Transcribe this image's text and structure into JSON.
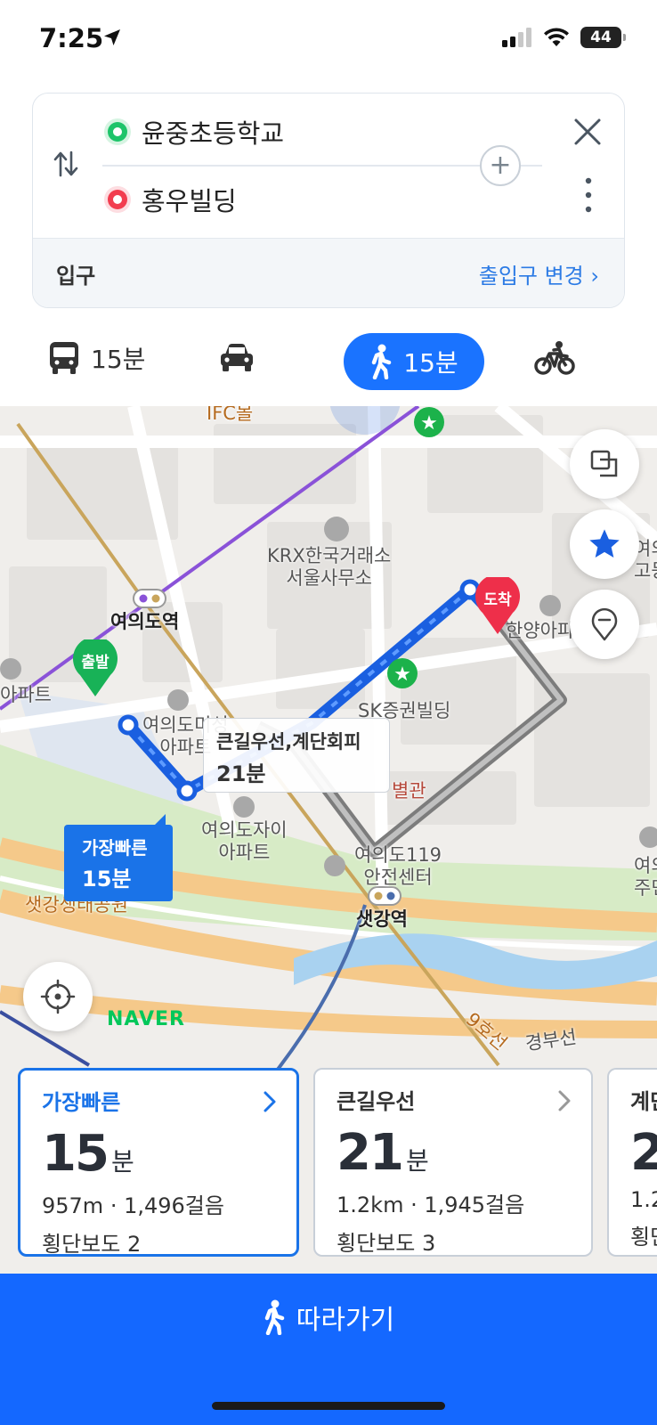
{
  "status": {
    "time": "7:25",
    "battery": "44"
  },
  "route": {
    "origin": "윤중초등학교",
    "destination": "홍우빌딩",
    "entrance_label": "입구",
    "entrance_change": "출입구 변경 ›"
  },
  "tabs": {
    "transit_time": "15분",
    "walk_time": "15분"
  },
  "map": {
    "labels": {
      "ifc": "IFC몰",
      "krx_1": "KRX한국거래소",
      "krx_2": "서울사무소",
      "yeouido_station": "여의도역",
      "apt_left": "아파트",
      "yeouido_apt_1": "여의도미성",
      "yeouido_apt_2": "아파트",
      "sk": "SK증권빌딩",
      "byeolgwan": "별관",
      "jai_1": "여의도자이",
      "jai_2": "아파트",
      "center_119_1": "여의도119",
      "center_119_2": "안전센터",
      "saetgang_station": "샛강역",
      "saetgang_park": "샛강생태공원",
      "hanyang": "한양아파",
      "right_1": "여의",
      "right_2": "고등",
      "right_3": "여의",
      "right_4": "주민",
      "line9": "9호선",
      "gyeongbu": "경부선"
    },
    "pins": {
      "start": "출발",
      "arrive": "도착"
    },
    "callout": {
      "title": "큰길우선,계단회피",
      "time": "21분"
    },
    "fastest": {
      "label": "가장빠른",
      "time": "15분"
    },
    "logo": "NAVER"
  },
  "results": [
    {
      "title": "가장빠른",
      "minutes": "15",
      "unit": "분",
      "dist": "957m · 1,496걸음",
      "cross": "횡단보도 2"
    },
    {
      "title": "큰길우선",
      "minutes": "21",
      "unit": "분",
      "dist": "1.2km · 1,945걸음",
      "cross": "횡단보도 3"
    },
    {
      "title": "계단",
      "minutes": "2",
      "unit": "",
      "dist": "1.2",
      "cross": "횡단"
    }
  ],
  "follow_label": "따라가기",
  "colors": {
    "accent": "#1a73e8",
    "button": "#1468ff",
    "origin": "#1ec46a",
    "destination": "#f23d4f"
  }
}
